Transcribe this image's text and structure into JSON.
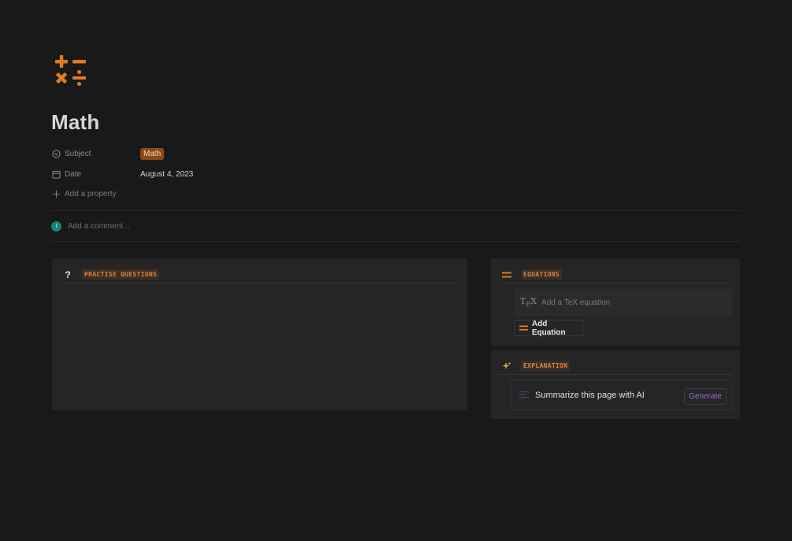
{
  "page": {
    "title": "Math",
    "icon": "plus-minus-times-divide-icon"
  },
  "properties": {
    "subject_label": "Subject",
    "subject_value": "Math",
    "date_label": "Date",
    "date_value": "August 4, 2023",
    "add_property": "Add a property"
  },
  "comment": {
    "avatar_initial": "I",
    "placeholder": "Add a comment..."
  },
  "practise": {
    "icon_glyph": "?",
    "label": "PRACTISE QUESTIONS"
  },
  "equations": {
    "label": "EQUATIONS",
    "tex_placeholder": "Add a TeX equation",
    "add_button": "Add Equation"
  },
  "explanation": {
    "label": "EXPLANATION",
    "ai_text": "Summarize this page with AI",
    "generate_button": "Generate"
  },
  "colors": {
    "background": "#191919",
    "accent_orange": "#e07b23",
    "tag_brown": "#8a4a16",
    "ai_purple": "#9a6fd0",
    "avatar_teal": "#16867a"
  }
}
